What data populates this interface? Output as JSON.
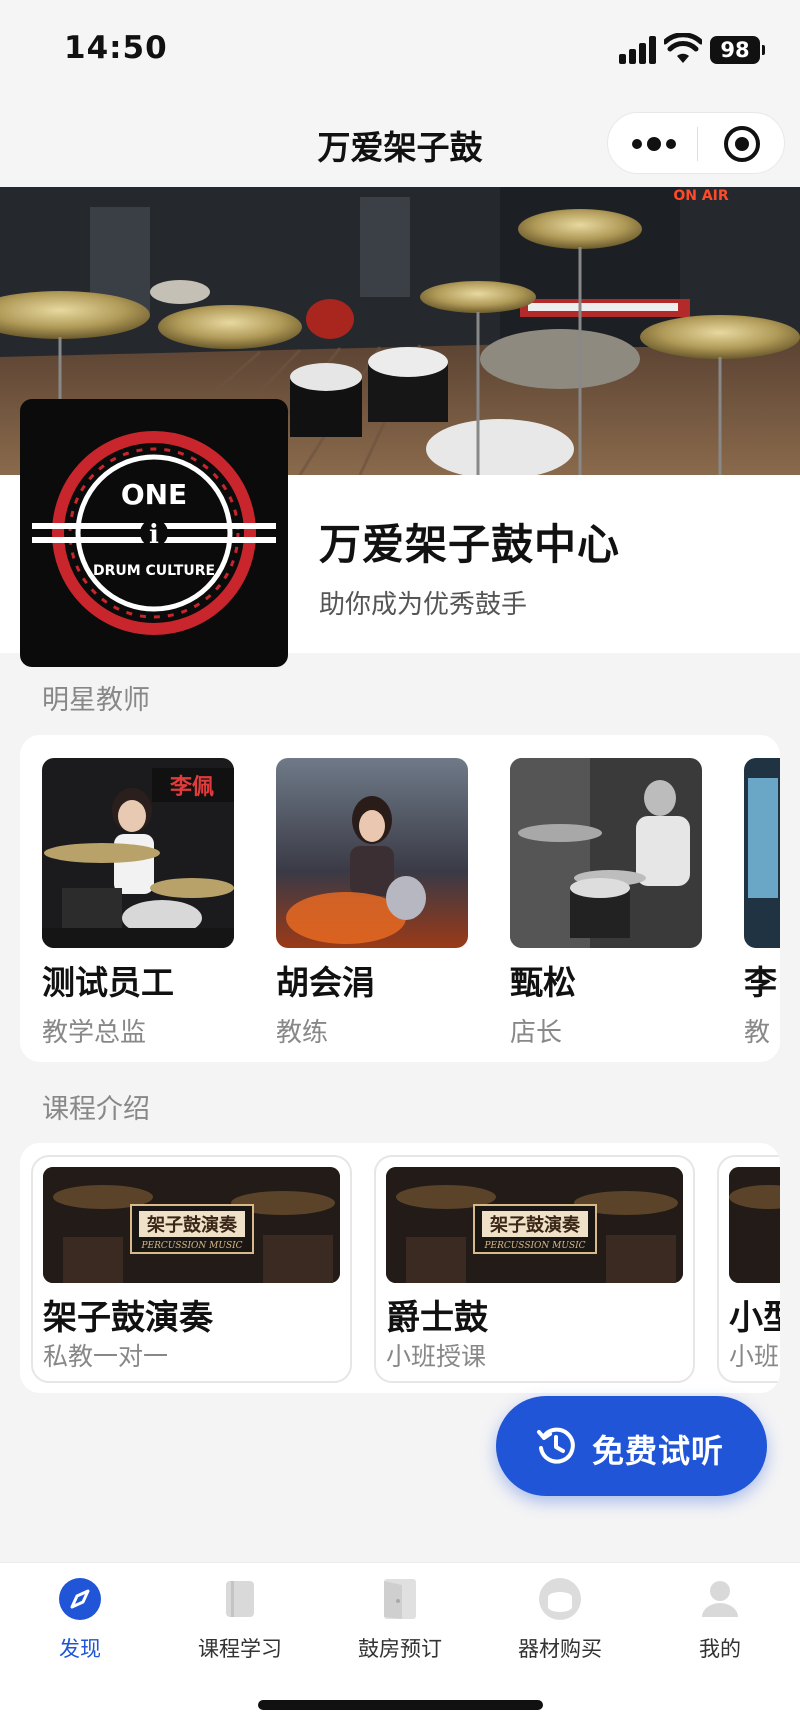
{
  "status_bar": {
    "time": "14:50",
    "battery": "98"
  },
  "nav": {
    "title": "万爱架子鼓"
  },
  "banner": {
    "sign_text": "ON AIR"
  },
  "logo": {
    "line1": "ONE",
    "line2": "i",
    "line3": "DRUM CULTURE"
  },
  "center": {
    "name": "万爱架子鼓中心",
    "subtitle": "助你成为优秀鼓手"
  },
  "teachers": {
    "title": "明星教师",
    "items": [
      {
        "name": "测试员工",
        "role": "教学总监",
        "photo_text": "李佩"
      },
      {
        "name": "胡会涓",
        "role": "教练"
      },
      {
        "name": "甄松",
        "role": "店长"
      },
      {
        "name": "李",
        "role": "教"
      }
    ]
  },
  "courses": {
    "title": "课程介绍",
    "items": [
      {
        "name": "架子鼓演奏",
        "sub": "私教一对一",
        "img_title": "架子鼓演奏",
        "img_en": "PERCUSSION MUSIC"
      },
      {
        "name": "爵士鼓",
        "sub": "小班授课",
        "img_title": "架子鼓演奏",
        "img_en": "PERCUSSION MUSIC"
      },
      {
        "name": "小型",
        "sub": "小班"
      }
    ]
  },
  "trial_button": {
    "label": "免费试听",
    "icon": "history-clock-icon"
  },
  "tabbar": {
    "tabs": [
      {
        "label": "发现",
        "icon": "compass-icon",
        "active": true
      },
      {
        "label": "课程学习",
        "icon": "book-icon",
        "active": false
      },
      {
        "label": "鼓房预订",
        "icon": "door-icon",
        "active": false
      },
      {
        "label": "器材购买",
        "icon": "drum-icon",
        "active": false
      },
      {
        "label": "我的",
        "icon": "user-icon",
        "active": false
      }
    ]
  },
  "colors": {
    "accent": "#1f55d6",
    "logo_red": "#c8262c"
  }
}
